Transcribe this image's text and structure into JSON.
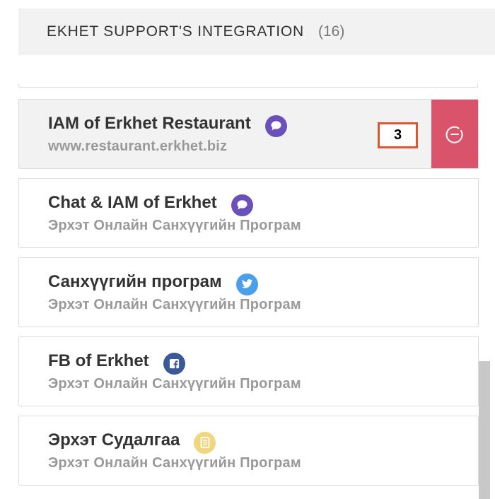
{
  "header": {
    "title": "EKHET SUPPORT'S INTEGRATION",
    "count": "(16)"
  },
  "integrations": [
    {
      "title": "IAM of Erkhet Restaurant",
      "subtitle": "www.restaurant.erkhet.biz",
      "icon": "messenger-icon",
      "count": "3",
      "active": true
    },
    {
      "title": "Chat & IAM of Erkhet",
      "subtitle": "Эрхэт Онлайн Санхүүгийн Програм",
      "icon": "messenger-icon"
    },
    {
      "title": "Санхүүгийн програм",
      "subtitle": "Эрхэт Онлайн Санхүүгийн Програм",
      "icon": "twitter-icon"
    },
    {
      "title": "FB of Erkhet",
      "subtitle": "Эрхэт Онлайн Санхүүгийн Програм",
      "icon": "facebook-icon"
    },
    {
      "title": "Эрхэт Судалгаа",
      "subtitle": "Эрхэт Онлайн Санхүүгийн Програм",
      "icon": "form-icon"
    }
  ],
  "colors": {
    "remove_button": "#d9536a",
    "messenger": "#6b4fbb",
    "twitter": "#4a9fea",
    "facebook": "#3b5998",
    "form": "#f0d67c",
    "count_border": "#e2542f"
  }
}
